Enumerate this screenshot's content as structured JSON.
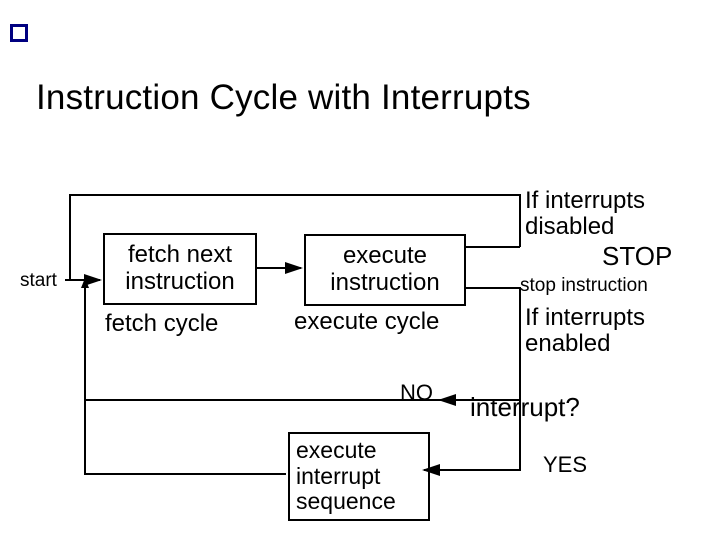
{
  "title": "Instruction Cycle with Interrupts",
  "labels": {
    "start": "start",
    "fetch_box": "fetch next\ninstruction",
    "fetch_cycle": "fetch cycle",
    "exec_box": "execute\ninstruction",
    "exec_cycle": "execute cycle",
    "if_disabled": "If interrupts\ndisabled",
    "stop_caps": "STOP",
    "stop_instruction": "stop instruction",
    "if_enabled": "If interrupts\nenabled",
    "no": "NO",
    "interrupt_q": "interrupt?",
    "yes": "YES",
    "exec_int_seq": "execute\ninterrupt\nsequence"
  }
}
